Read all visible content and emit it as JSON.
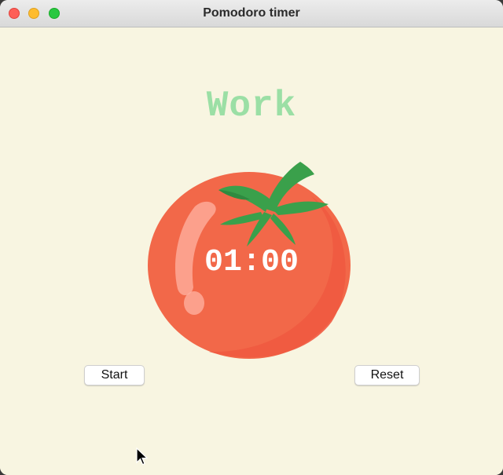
{
  "window": {
    "title": "Pomodoro timer"
  },
  "timer": {
    "mode_label": "Work",
    "display": "01:00",
    "mode_color": "#9bdfa5",
    "tomato_color": "#f26849",
    "leaf_color": "#3aa04b"
  },
  "controls": {
    "start_label": "Start",
    "reset_label": "Reset"
  }
}
